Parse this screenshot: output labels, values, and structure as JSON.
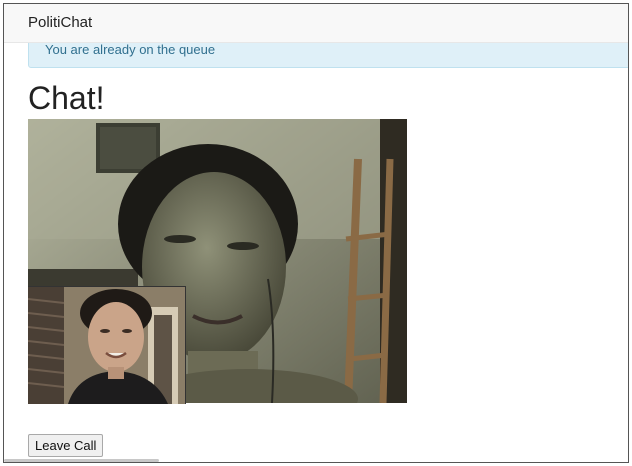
{
  "navbar": {
    "brand": "PolitiChat"
  },
  "alert": {
    "message": "You are already on the queue"
  },
  "main": {
    "title": "Chat!",
    "leave_button_label": "Leave Call"
  },
  "icons": {
    "remote_video": "remote-video-feed",
    "local_video": "local-video-feed"
  }
}
